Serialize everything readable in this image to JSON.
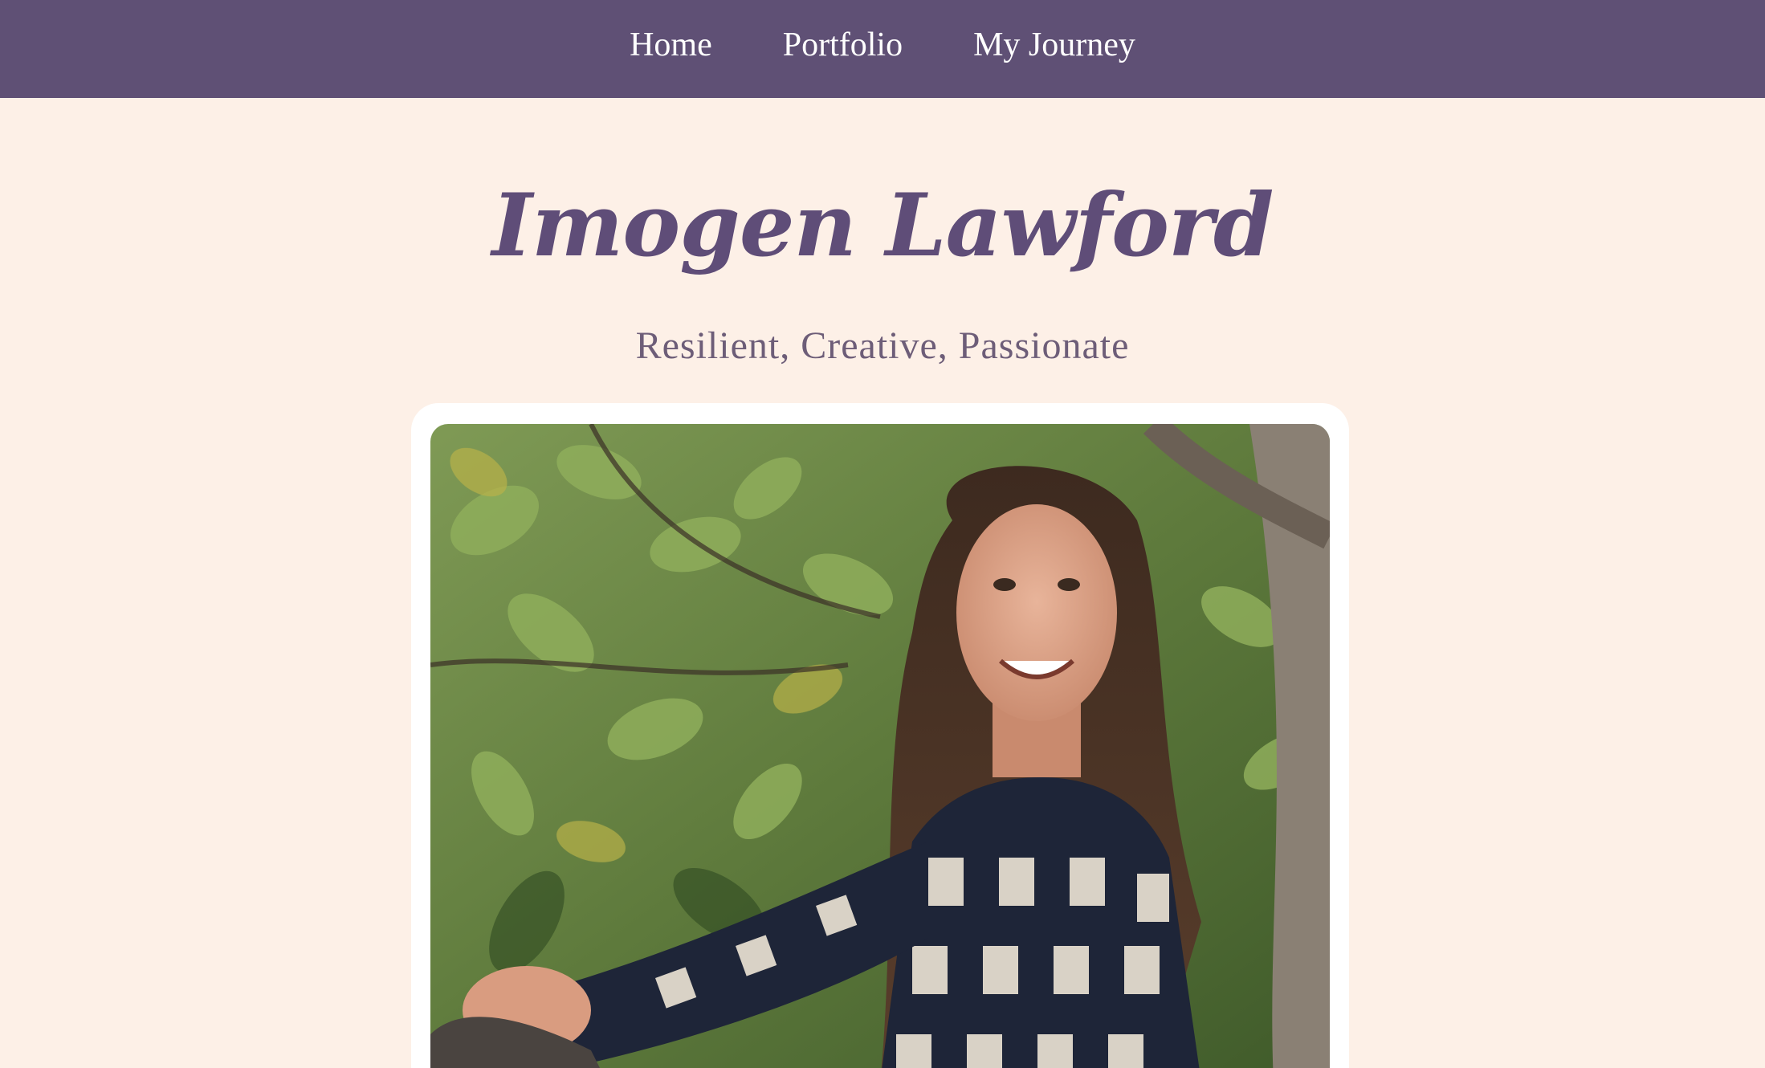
{
  "nav": {
    "items": [
      {
        "label": "Home"
      },
      {
        "label": "Portfolio"
      },
      {
        "label": "My Journey"
      }
    ]
  },
  "hero": {
    "title": "Imogen Lawford",
    "tagline": "Resilient, Creative, Passionate"
  },
  "colors": {
    "nav_background": "#5f5075",
    "page_background": "#fdf0e7",
    "title": "#5f4d78",
    "tagline": "#6d5d78"
  }
}
